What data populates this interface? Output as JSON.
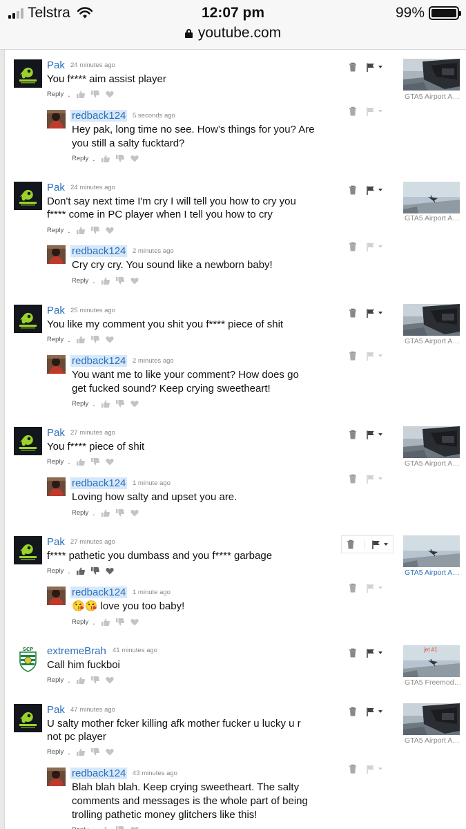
{
  "status_bar": {
    "carrier": "Telstra",
    "time": "12:07 pm",
    "battery": "99%",
    "battery_level": 0.99
  },
  "url_bar": {
    "domain": "youtube.com"
  },
  "actions": {
    "reply_label": "Reply",
    "separator": "."
  },
  "comments": [
    {
      "author": "Pak",
      "time": "24 minutes ago",
      "text": "You f**** aim assist player",
      "video_title": "GTA5 Airport A…",
      "reply": {
        "author": "redback124",
        "time": "5 seconds ago",
        "text_lines": [
          "Hey pak, long time no see. How’s things for you? Are",
          "you still a salty fucktard?"
        ]
      }
    },
    {
      "author": "Pak",
      "time": "24 minutes ago",
      "text_lines": [
        "Don't say next time I'm cry I will tell you how to cry you",
        "f**** come in PC player when I tell you how to cry"
      ],
      "video_title": "GTA5 Airport A…",
      "reply": {
        "author": "redback124",
        "time": "2 minutes ago",
        "text_lines": [
          "Cry cry cry. You sound like a newborn baby!"
        ]
      }
    },
    {
      "author": "Pak",
      "time": "25 minutes ago",
      "text": "You like my comment you shit you f**** piece of shit",
      "video_title": "GTA5 Airport A…",
      "reply": {
        "author": "redback124",
        "time": "2 minutes ago",
        "text_lines": [
          "You want me to like your comment? How does go",
          "get fucked sound? Keep crying sweetheart!"
        ]
      }
    },
    {
      "author": "Pak",
      "time": "27 minutes ago",
      "text": "You f**** piece of shit",
      "video_title": "GTA5 Airport A…",
      "reply": {
        "author": "redback124",
        "time": "1 minute ago",
        "text_lines": [
          "Loving how salty and upset you are."
        ]
      }
    },
    {
      "author": "Pak",
      "time": "27 minutes ago",
      "text": "f**** pathetic you dumbass and you f**** garbage",
      "video_title": "GTA5 Airport A…",
      "reply": {
        "author": "redback124",
        "time": "1 minute ago",
        "text_lines": [
          "😘😘 love you too baby!"
        ]
      }
    },
    {
      "author": "extremeBrah",
      "time": "41 minutes ago",
      "text": "Call him fuckboi",
      "video_title": "GTA5 Freemod…",
      "video_overlay": "jet #1"
    },
    {
      "author": "Pak",
      "time": "47 minutes ago",
      "text_lines": [
        "U salty mother fcker killing afk mother fucker u lucky u r",
        "not pc player"
      ],
      "video_title": "GTA5 Airport A…",
      "reply": {
        "author": "redback124",
        "time": "43 minutes ago",
        "text_lines": [
          "Blah blah blah. Keep crying sweetheart. The salty",
          "comments and messages is the whole part of being",
          "trolling pathetic money glitchers like this!"
        ]
      }
    }
  ],
  "colors": {
    "link": "#2b6fb8",
    "highlight": "#d7e8fb",
    "muted": "#888888"
  },
  "icons": {
    "like": "thumbs-up-icon",
    "dislike": "thumbs-down-icon",
    "heart": "heart-icon",
    "delete": "trash-icon",
    "flag": "flag-icon",
    "menu": "caret-down-icon"
  }
}
